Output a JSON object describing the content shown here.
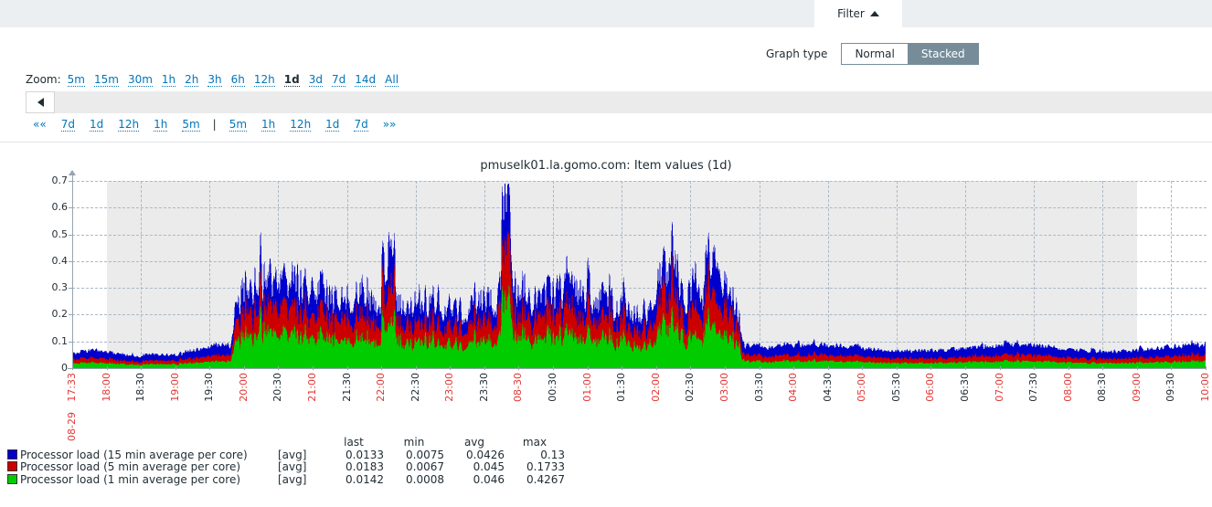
{
  "header": {
    "filter_tab_label": "Filter",
    "filter_caret": "caret-up-icon"
  },
  "filter": {
    "graph_type_label": "Graph type",
    "options": [
      {
        "label": "Normal",
        "selected": false
      },
      {
        "label": "Stacked",
        "selected": true
      }
    ]
  },
  "zoom": {
    "label": "Zoom:",
    "links": [
      {
        "label": "5m",
        "active": false
      },
      {
        "label": "15m",
        "active": false
      },
      {
        "label": "30m",
        "active": false
      },
      {
        "label": "1h",
        "active": false
      },
      {
        "label": "2h",
        "active": false
      },
      {
        "label": "3h",
        "active": false
      },
      {
        "label": "6h",
        "active": false
      },
      {
        "label": "12h",
        "active": false
      },
      {
        "label": "1d",
        "active": true
      },
      {
        "label": "3d",
        "active": false
      },
      {
        "label": "7d",
        "active": false
      },
      {
        "label": "14d",
        "active": false
      },
      {
        "label": "All",
        "active": false
      }
    ]
  },
  "nav": {
    "scroll_left_icon": "triangle-left-icon",
    "period_links": [
      {
        "label": "««",
        "dotted": false
      },
      {
        "label": "7d",
        "dotted": true
      },
      {
        "label": "1d",
        "dotted": true
      },
      {
        "label": "12h",
        "dotted": true
      },
      {
        "label": "1h",
        "dotted": true
      },
      {
        "label": "5m",
        "dotted": true
      },
      {
        "label": "|",
        "separator": true
      },
      {
        "label": "5m",
        "dotted": true
      },
      {
        "label": "1h",
        "dotted": true
      },
      {
        "label": "12h",
        "dotted": true
      },
      {
        "label": "1d",
        "dotted": true
      },
      {
        "label": "7d",
        "dotted": true
      },
      {
        "label": "»»",
        "dotted": false
      }
    ]
  },
  "graph": {
    "title": "pmuselk01.la.gomo.com: Item values (1d)"
  },
  "legend": {
    "columns": [
      "last",
      "min",
      "avg",
      "max"
    ],
    "rows": [
      {
        "color": "#0000CC",
        "name": "Processor load (15 min average per core)",
        "fn": "[avg]",
        "last": "0.0133",
        "min": "0.0075",
        "avg": "0.0426",
        "max": "0.13"
      },
      {
        "color": "#CC0000",
        "name": "Processor load (5 min average per core)",
        "fn": "[avg]",
        "last": "0.0183",
        "min": "0.0067",
        "avg": "0.045",
        "max": "0.1733"
      },
      {
        "color": "#00CC00",
        "name": "Processor load (1 min average per core)",
        "fn": "[avg]",
        "last": "0.0142",
        "min": "0.0008",
        "avg": "0.046",
        "max": "0.4267"
      }
    ]
  },
  "chart_data": {
    "type": "area",
    "stacked": true,
    "title": "pmuselk01.la.gomo.com: Item values (1d)",
    "xlabel": "",
    "ylabel": "",
    "ylim": [
      0,
      0.7
    ],
    "ytick_labels": [
      "0",
      "0.1",
      "0.2",
      "0.3",
      "0.4",
      "0.5",
      "0.6",
      "0.7"
    ],
    "ytick_values": [
      0,
      0.1,
      0.2,
      0.3,
      0.4,
      0.5,
      0.6,
      0.7
    ],
    "grid": true,
    "legend_position": "below",
    "x_start": "08-29 17:33",
    "x_end": "08-30 10:00",
    "working_time_shading": {
      "from": "18:00",
      "to": "09:00",
      "color": "#ebebeb"
    },
    "xtick_labels": [
      {
        "label": "08-29 17:33",
        "color": "red",
        "two_line": true
      },
      {
        "label": "18:00",
        "color": "red"
      },
      {
        "label": "18:30",
        "color": "dark"
      },
      {
        "label": "19:00",
        "color": "red"
      },
      {
        "label": "19:30",
        "color": "dark"
      },
      {
        "label": "20:00",
        "color": "red"
      },
      {
        "label": "20:30",
        "color": "dark"
      },
      {
        "label": "21:00",
        "color": "red"
      },
      {
        "label": "21:30",
        "color": "dark"
      },
      {
        "label": "22:00",
        "color": "red"
      },
      {
        "label": "22:30",
        "color": "dark"
      },
      {
        "label": "23:00",
        "color": "red"
      },
      {
        "label": "23:30",
        "color": "dark"
      },
      {
        "label": "08-30",
        "color": "red"
      },
      {
        "label": "00:30",
        "color": "dark"
      },
      {
        "label": "01:00",
        "color": "red"
      },
      {
        "label": "01:30",
        "color": "dark"
      },
      {
        "label": "02:00",
        "color": "red"
      },
      {
        "label": "02:30",
        "color": "dark"
      },
      {
        "label": "03:00",
        "color": "red"
      },
      {
        "label": "03:30",
        "color": "dark"
      },
      {
        "label": "04:00",
        "color": "red"
      },
      {
        "label": "04:30",
        "color": "dark"
      },
      {
        "label": "05:00",
        "color": "red"
      },
      {
        "label": "05:30",
        "color": "dark"
      },
      {
        "label": "06:00",
        "color": "red"
      },
      {
        "label": "06:30",
        "color": "dark"
      },
      {
        "label": "07:00",
        "color": "red"
      },
      {
        "label": "07:30",
        "color": "dark"
      },
      {
        "label": "08:00",
        "color": "red"
      },
      {
        "label": "08:30",
        "color": "dark"
      },
      {
        "label": "09:00",
        "color": "red"
      },
      {
        "label": "09:30",
        "color": "dark"
      },
      {
        "label": "10:00",
        "color": "red"
      }
    ],
    "series": [
      {
        "name": "Processor load (1 min average per core)",
        "color": "#00CC00",
        "stack_order": 0,
        "stats": {
          "last": 0.0142,
          "min": 0.0008,
          "avg": 0.046,
          "max": 0.4267
        }
      },
      {
        "name": "Processor load (5 min average per core)",
        "color": "#CC0000",
        "stack_order": 1,
        "stats": {
          "last": 0.0183,
          "min": 0.0067,
          "avg": 0.045,
          "max": 0.1733
        }
      },
      {
        "name": "Processor load (15 min average per core)",
        "color": "#0000CC",
        "stack_order": 2,
        "stats": {
          "last": 0.0133,
          "min": 0.0075,
          "avg": 0.0426,
          "max": 0.13
        }
      }
    ],
    "profile_notes": "Low baseline ~0.04-0.09 total from 17:33-19:30; ramp up 19:30-20:00; sustained busy plateau 20:00-03:00 with stacked totals 0.15-0.48; sharp isolated spike to 0.67 near 23:45; secondary peaks ~0.46 near 02:10 and 02:45; steep fall after 03:00 to a quiet baseline 0.05-0.13 through 10:00."
  }
}
